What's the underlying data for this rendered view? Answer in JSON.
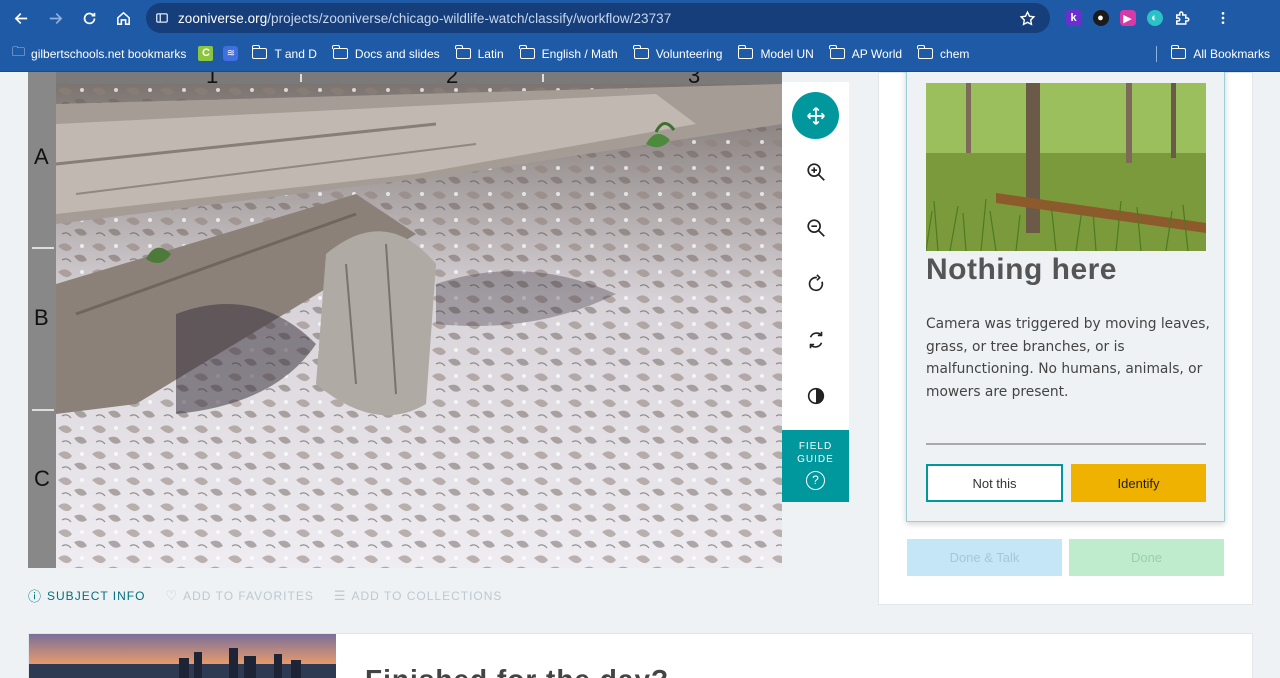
{
  "browser": {
    "url_host": "zooniverse.org",
    "url_path": "/projects/zooniverse/chicago-wildlife-watch/classify/workflow/23737",
    "bookmarks": [
      "gilbertschools.net bookmarks",
      "T and D",
      "Docs and slides",
      "Latin",
      "English / Math",
      "Volunteering",
      "Model UN",
      "AP World",
      "chem"
    ],
    "all_bookmarks": "All Bookmarks"
  },
  "subject": {
    "row_labels": [
      "A",
      "B",
      "C"
    ],
    "col_labels": [
      "1",
      "2",
      "3"
    ]
  },
  "toolbar": {
    "tools": [
      "move-icon",
      "zoom-in-icon",
      "zoom-out-icon",
      "rotate-icon",
      "invert-icon",
      "contrast-icon"
    ],
    "field_guide_line1": "FIELD",
    "field_guide_line2": "GUIDE",
    "help_glyph": "?"
  },
  "meta": {
    "subject_info": "SUBJECT INFO",
    "add_to_favorites": "ADD TO FAVORITES",
    "add_to_collections": "ADD TO COLLECTIONS"
  },
  "choice": {
    "title": "Nothing here",
    "description": "Camera was triggered by moving leaves, grass, or tree branches, or is malfunctioning. No humans, animals, or mowers are present.",
    "not_this": "Not this",
    "identify": "Identify"
  },
  "actions": {
    "done_talk": "Done & Talk",
    "done": "Done"
  },
  "bottom": {
    "heading": "Finished for the day?"
  },
  "colors": {
    "accent": "#00979d",
    "identify": "#f0b200",
    "chrome": "#1f5aa6"
  }
}
